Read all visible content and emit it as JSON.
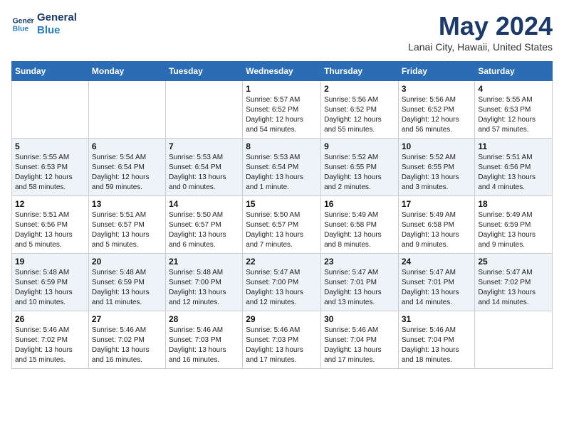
{
  "logo": {
    "line1": "General",
    "line2": "Blue"
  },
  "header": {
    "month": "May 2024",
    "location": "Lanai City, Hawaii, United States"
  },
  "weekdays": [
    "Sunday",
    "Monday",
    "Tuesday",
    "Wednesday",
    "Thursday",
    "Friday",
    "Saturday"
  ],
  "weeks": [
    [
      {
        "day": "",
        "info": ""
      },
      {
        "day": "",
        "info": ""
      },
      {
        "day": "",
        "info": ""
      },
      {
        "day": "1",
        "info": "Sunrise: 5:57 AM\nSunset: 6:52 PM\nDaylight: 12 hours\nand 54 minutes."
      },
      {
        "day": "2",
        "info": "Sunrise: 5:56 AM\nSunset: 6:52 PM\nDaylight: 12 hours\nand 55 minutes."
      },
      {
        "day": "3",
        "info": "Sunrise: 5:56 AM\nSunset: 6:52 PM\nDaylight: 12 hours\nand 56 minutes."
      },
      {
        "day": "4",
        "info": "Sunrise: 5:55 AM\nSunset: 6:53 PM\nDaylight: 12 hours\nand 57 minutes."
      }
    ],
    [
      {
        "day": "5",
        "info": "Sunrise: 5:55 AM\nSunset: 6:53 PM\nDaylight: 12 hours\nand 58 minutes."
      },
      {
        "day": "6",
        "info": "Sunrise: 5:54 AM\nSunset: 6:54 PM\nDaylight: 12 hours\nand 59 minutes."
      },
      {
        "day": "7",
        "info": "Sunrise: 5:53 AM\nSunset: 6:54 PM\nDaylight: 13 hours\nand 0 minutes."
      },
      {
        "day": "8",
        "info": "Sunrise: 5:53 AM\nSunset: 6:54 PM\nDaylight: 13 hours\nand 1 minute."
      },
      {
        "day": "9",
        "info": "Sunrise: 5:52 AM\nSunset: 6:55 PM\nDaylight: 13 hours\nand 2 minutes."
      },
      {
        "day": "10",
        "info": "Sunrise: 5:52 AM\nSunset: 6:55 PM\nDaylight: 13 hours\nand 3 minutes."
      },
      {
        "day": "11",
        "info": "Sunrise: 5:51 AM\nSunset: 6:56 PM\nDaylight: 13 hours\nand 4 minutes."
      }
    ],
    [
      {
        "day": "12",
        "info": "Sunrise: 5:51 AM\nSunset: 6:56 PM\nDaylight: 13 hours\nand 5 minutes."
      },
      {
        "day": "13",
        "info": "Sunrise: 5:51 AM\nSunset: 6:57 PM\nDaylight: 13 hours\nand 5 minutes."
      },
      {
        "day": "14",
        "info": "Sunrise: 5:50 AM\nSunset: 6:57 PM\nDaylight: 13 hours\nand 6 minutes."
      },
      {
        "day": "15",
        "info": "Sunrise: 5:50 AM\nSunset: 6:57 PM\nDaylight: 13 hours\nand 7 minutes."
      },
      {
        "day": "16",
        "info": "Sunrise: 5:49 AM\nSunset: 6:58 PM\nDaylight: 13 hours\nand 8 minutes."
      },
      {
        "day": "17",
        "info": "Sunrise: 5:49 AM\nSunset: 6:58 PM\nDaylight: 13 hours\nand 9 minutes."
      },
      {
        "day": "18",
        "info": "Sunrise: 5:49 AM\nSunset: 6:59 PM\nDaylight: 13 hours\nand 9 minutes."
      }
    ],
    [
      {
        "day": "19",
        "info": "Sunrise: 5:48 AM\nSunset: 6:59 PM\nDaylight: 13 hours\nand 10 minutes."
      },
      {
        "day": "20",
        "info": "Sunrise: 5:48 AM\nSunset: 6:59 PM\nDaylight: 13 hours\nand 11 minutes."
      },
      {
        "day": "21",
        "info": "Sunrise: 5:48 AM\nSunset: 7:00 PM\nDaylight: 13 hours\nand 12 minutes."
      },
      {
        "day": "22",
        "info": "Sunrise: 5:47 AM\nSunset: 7:00 PM\nDaylight: 13 hours\nand 12 minutes."
      },
      {
        "day": "23",
        "info": "Sunrise: 5:47 AM\nSunset: 7:01 PM\nDaylight: 13 hours\nand 13 minutes."
      },
      {
        "day": "24",
        "info": "Sunrise: 5:47 AM\nSunset: 7:01 PM\nDaylight: 13 hours\nand 14 minutes."
      },
      {
        "day": "25",
        "info": "Sunrise: 5:47 AM\nSunset: 7:02 PM\nDaylight: 13 hours\nand 14 minutes."
      }
    ],
    [
      {
        "day": "26",
        "info": "Sunrise: 5:46 AM\nSunset: 7:02 PM\nDaylight: 13 hours\nand 15 minutes."
      },
      {
        "day": "27",
        "info": "Sunrise: 5:46 AM\nSunset: 7:02 PM\nDaylight: 13 hours\nand 16 minutes."
      },
      {
        "day": "28",
        "info": "Sunrise: 5:46 AM\nSunset: 7:03 PM\nDaylight: 13 hours\nand 16 minutes."
      },
      {
        "day": "29",
        "info": "Sunrise: 5:46 AM\nSunset: 7:03 PM\nDaylight: 13 hours\nand 17 minutes."
      },
      {
        "day": "30",
        "info": "Sunrise: 5:46 AM\nSunset: 7:04 PM\nDaylight: 13 hours\nand 17 minutes."
      },
      {
        "day": "31",
        "info": "Sunrise: 5:46 AM\nSunset: 7:04 PM\nDaylight: 13 hours\nand 18 minutes."
      },
      {
        "day": "",
        "info": ""
      }
    ]
  ]
}
